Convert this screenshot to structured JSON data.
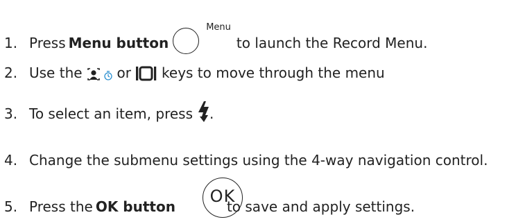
{
  "steps": [
    {
      "number": "1.",
      "pre": "Press ",
      "bold": "Menu button",
      "icon": "menu-button-icon",
      "icon_label": "Menu",
      "post": "to launch the Record Menu."
    },
    {
      "number": "2.",
      "pre": "Use the",
      "icons": [
        "face-detection-icon",
        "self-timer-icon",
        "display-mode-icon"
      ],
      "mid": "or",
      "post": "keys to move through the menu"
    },
    {
      "number": "3.",
      "pre": "To select an item, press",
      "icon": "flash-icon",
      "post": "."
    },
    {
      "number": "4.",
      "text": "Change the submenu settings using the 4-way navigation control."
    },
    {
      "number": "5.",
      "pre": "Press the ",
      "bold": "OK button",
      "icon": "ok-button-icon",
      "icon_label": "OK",
      "post": "to save and apply settings."
    }
  ]
}
